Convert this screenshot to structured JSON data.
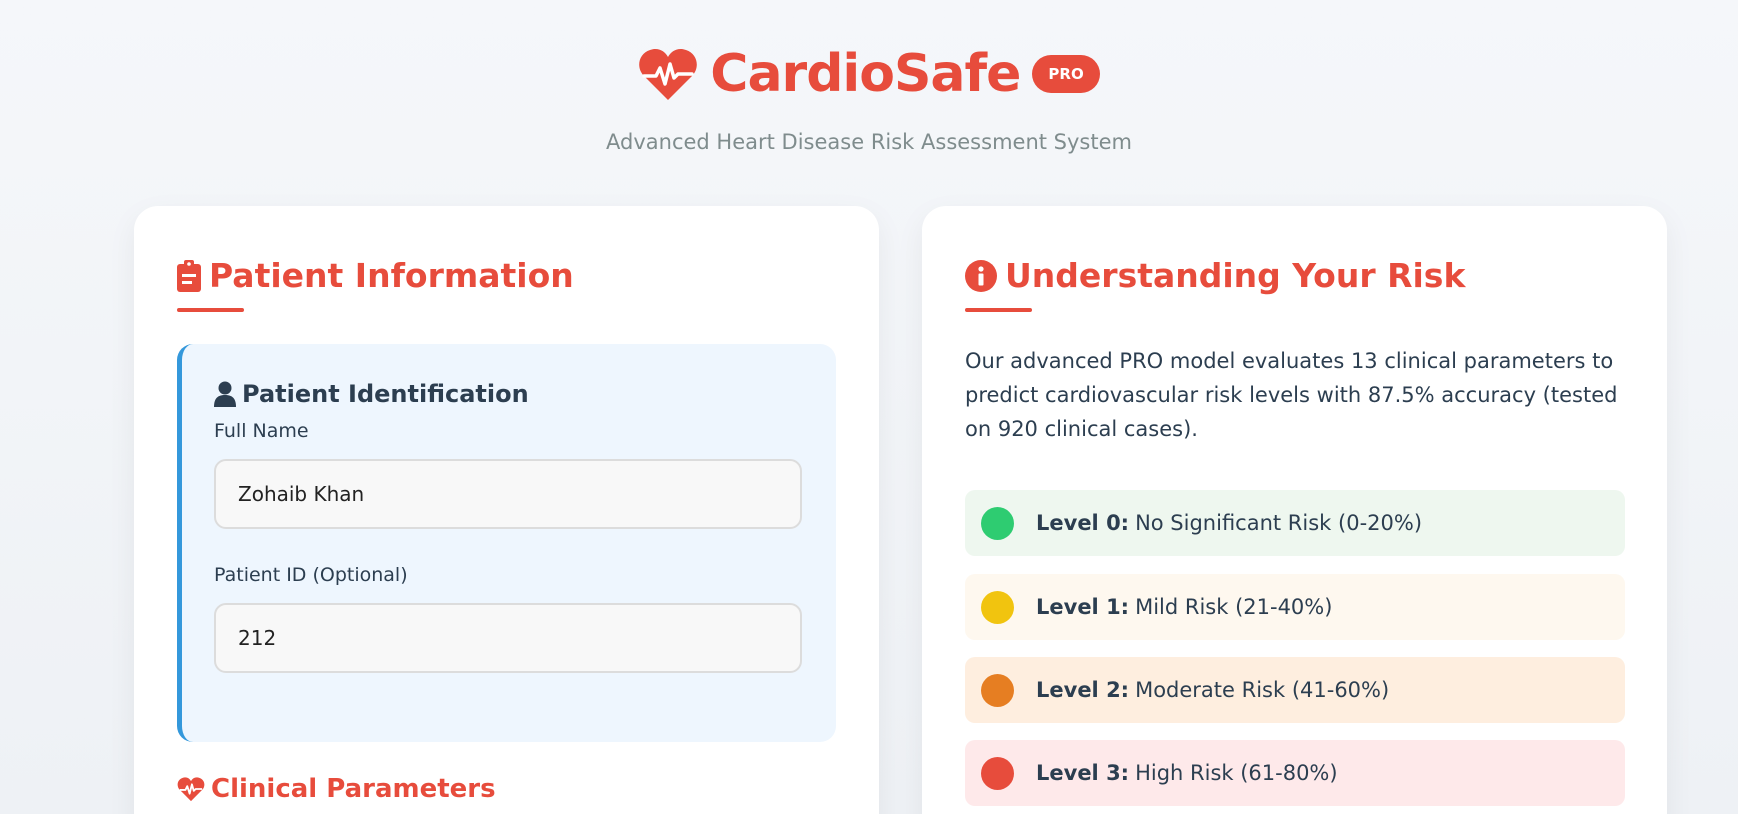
{
  "header": {
    "brand_name": "CardioSafe",
    "badge": "PRO",
    "subtitle": "Advanced Heart Disease Risk Assessment System",
    "logo_icon": "heartbeat-icon",
    "brand_color": "#e74c3c"
  },
  "patient_card": {
    "title": "Patient Information",
    "title_icon": "clipboard-icon",
    "identification": {
      "title": "Patient Identification",
      "title_icon": "user-icon",
      "full_name_label": "Full Name",
      "full_name_value": "Zohaib Khan",
      "patient_id_label": "Patient ID (Optional)",
      "patient_id_value": "212"
    },
    "clinical_title": "Clinical Parameters",
    "clinical_icon": "heartbeat-icon"
  },
  "risk_card": {
    "title": "Understanding Your Risk",
    "title_icon": "info-icon",
    "description": "Our advanced PRO model evaluates 13 clinical parameters to predict cardiovascular risk levels with 87.5% accuracy (tested on 920 clinical cases).",
    "levels": [
      {
        "label": "Level 0:",
        "text": "No Significant Risk (0-20%)",
        "dot_color": "#2ecc71",
        "bg_color": "#eef7ef"
      },
      {
        "label": "Level 1:",
        "text": "Mild Risk (21-40%)",
        "dot_color": "#f1c40f",
        "bg_color": "#fef8ef"
      },
      {
        "label": "Level 2:",
        "text": "Moderate Risk (41-60%)",
        "dot_color": "#e67e22",
        "bg_color": "#feeedf"
      },
      {
        "label": "Level 3:",
        "text": "High Risk (61-80%)",
        "dot_color": "#e74c3c",
        "bg_color": "#fee9ea"
      }
    ]
  }
}
